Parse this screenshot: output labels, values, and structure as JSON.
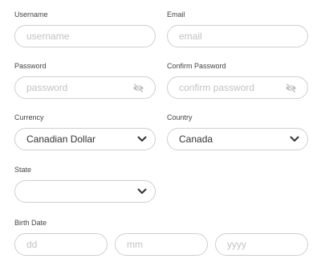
{
  "form": {
    "username": {
      "label": "Username",
      "placeholder": "username",
      "value": ""
    },
    "email": {
      "label": "Email",
      "placeholder": "email",
      "value": ""
    },
    "password": {
      "label": "Password",
      "placeholder": "password",
      "value": ""
    },
    "confirm_password": {
      "label": "Confirm Password",
      "placeholder": "confirm password",
      "value": ""
    },
    "currency": {
      "label": "Currency",
      "selected": "Canadian Dollar"
    },
    "country": {
      "label": "Country",
      "selected": "Canada"
    },
    "state": {
      "label": "State",
      "selected": ""
    },
    "birth_date": {
      "label": "Birth Date",
      "day_placeholder": "dd",
      "month_placeholder": "mm",
      "year_placeholder": "yyyy"
    }
  },
  "icons": {
    "password_toggle": "eye-slash-icon",
    "select_arrow": "chevron-down-icon"
  },
  "colors": {
    "border": "#cfcfcf",
    "placeholder": "#c2c2c2",
    "icon": "#bcbcbc",
    "chevron": "#333333"
  }
}
